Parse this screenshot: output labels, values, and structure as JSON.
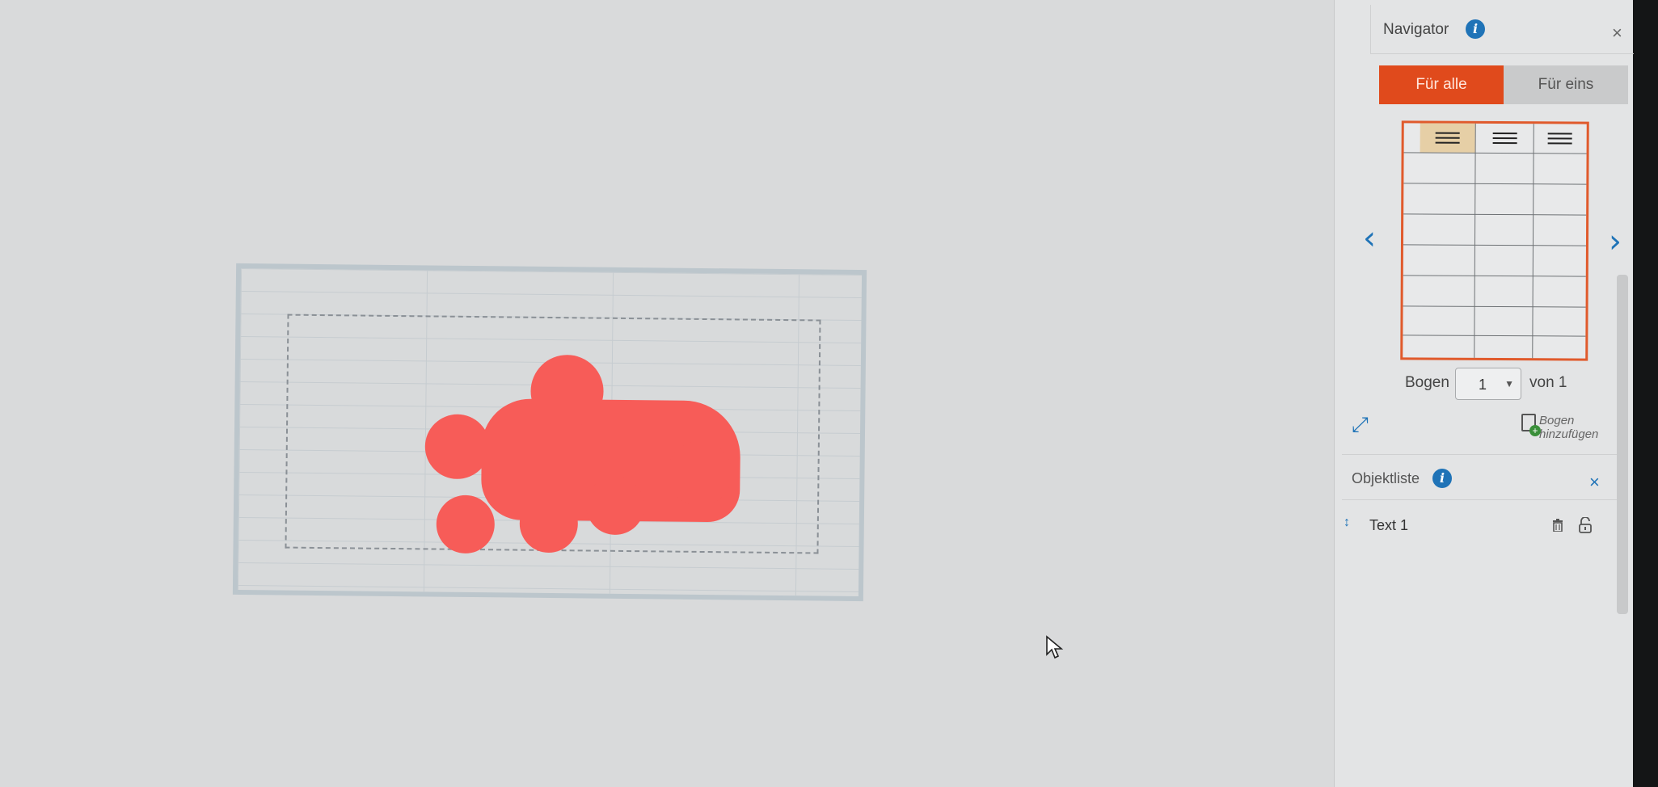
{
  "navigator": {
    "title": "Navigator",
    "info_icon": "info-icon",
    "tabs": [
      {
        "label": "Für alle",
        "active": true
      },
      {
        "label": "Für eins",
        "active": false
      }
    ],
    "prev_icon": "chevron-left-icon",
    "next_icon": "chevron-right-icon",
    "sheet_label": "Bogen",
    "sheet_value": "1",
    "sheet_total": "von 1",
    "expand_icon": "expand-icon",
    "add_sheet_label": "Bogen hinzufügen"
  },
  "object_list": {
    "title": "Objektliste",
    "items": [
      {
        "name": "Text 1",
        "icons": [
          "drag-handle-icon",
          "trash-icon",
          "unlock-icon"
        ]
      }
    ]
  },
  "colors": {
    "accent": "#e04a1c",
    "link": "#1f73b7",
    "redaction": "#f75c58"
  }
}
